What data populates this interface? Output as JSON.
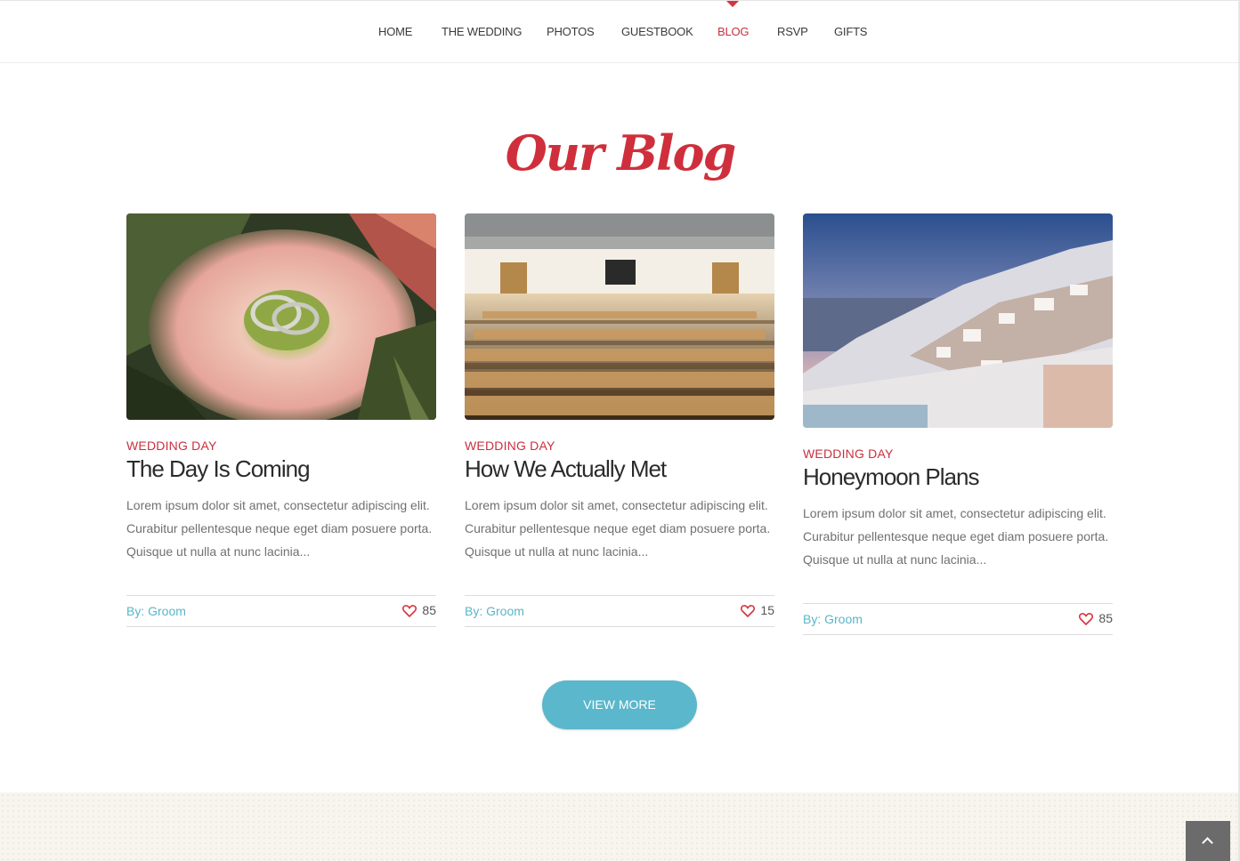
{
  "nav": {
    "items": [
      {
        "label": "HOME"
      },
      {
        "label": "THE WEDDING"
      },
      {
        "label": "PHOTOS"
      },
      {
        "label": "GUESTBOOK"
      },
      {
        "label": "BLOG"
      },
      {
        "label": "RSVP"
      },
      {
        "label": "GIFTS"
      }
    ],
    "active": "BLOG"
  },
  "section": {
    "title": "Our Blog"
  },
  "posts": [
    {
      "category": "WEDDING DAY",
      "title": "The Day Is Coming",
      "excerpt": "Lorem ipsum dolor sit amet, consectetur adipiscing elit. Curabitur pellentesque neque eget diam posuere porta. Quisque ut nulla at nunc lacinia...",
      "author": "By: Groom",
      "likes": "85",
      "image": "wedding-rings-on-flower"
    },
    {
      "category": "WEDDING DAY",
      "title": "How We Actually Met",
      "excerpt": "Lorem ipsum dolor sit amet, consectetur adipiscing elit. Curabitur pellentesque neque eget diam posuere porta. Quisque ut nulla at nunc lacinia...",
      "author": "By: Groom",
      "likes": "15",
      "image": "auditorium-seats"
    },
    {
      "category": "WEDDING DAY",
      "title": "Honeymoon Plans",
      "excerpt": "Lorem ipsum dolor sit amet, consectetur adipiscing elit. Curabitur pellentesque neque eget diam posuere porta. Quisque ut nulla at nunc lacinia...",
      "author": "By: Groom",
      "likes": "85",
      "image": "santorini-village"
    }
  ],
  "buttons": {
    "view_more": "VIEW MORE"
  },
  "colors": {
    "accent_red": "#c9303e",
    "accent_blue": "#5bb7cb",
    "text_dark": "#2b2b2b"
  },
  "icons": {
    "like": "heart-icon",
    "back_to_top": "chevron-up-icon"
  }
}
